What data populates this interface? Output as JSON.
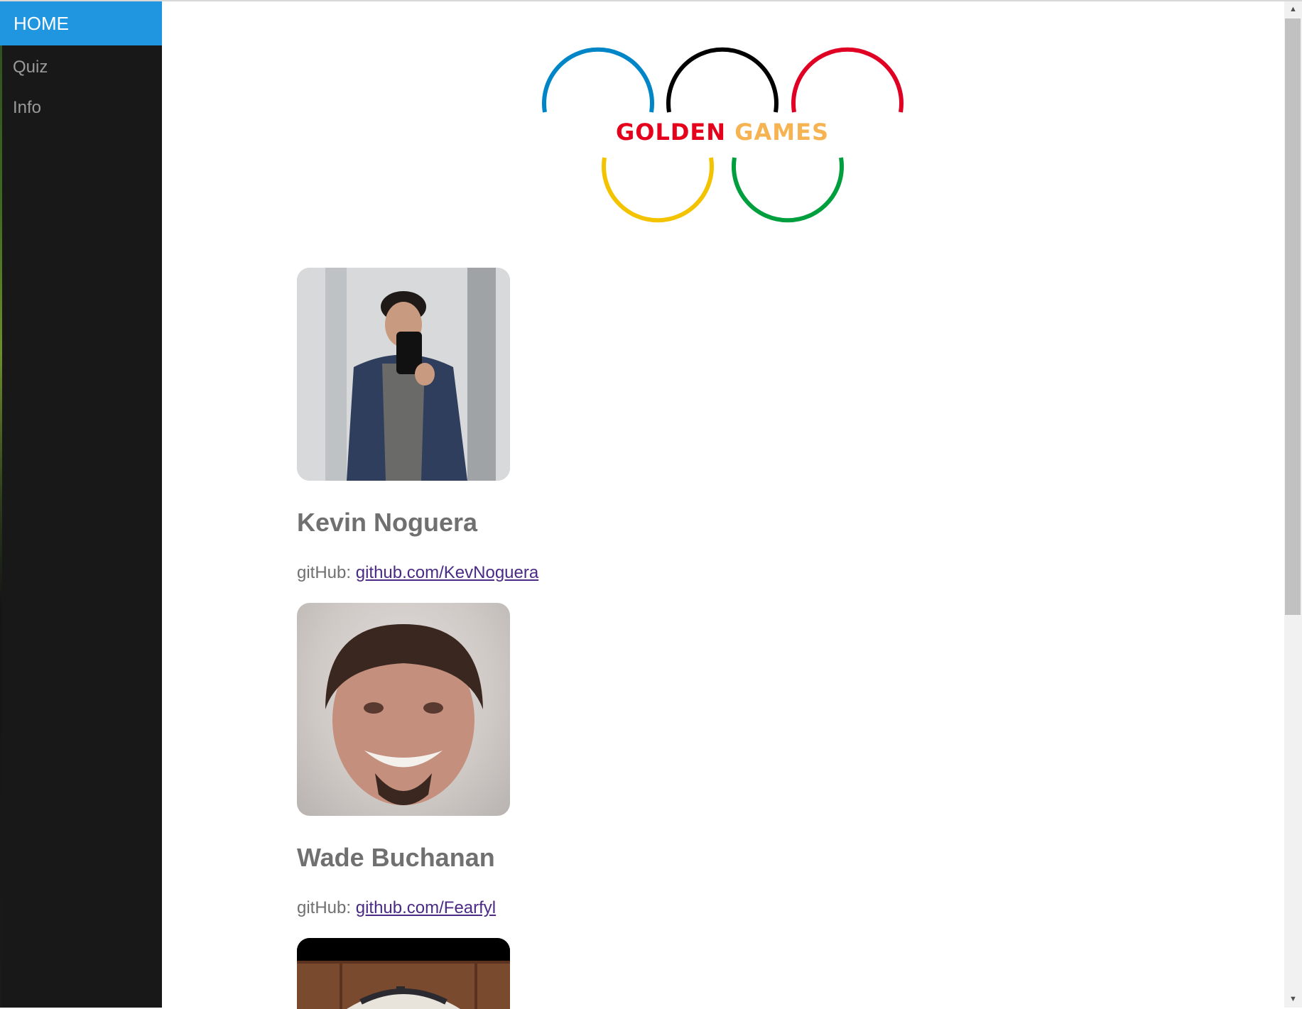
{
  "nav": {
    "items": [
      {
        "label": "HOME",
        "active": true
      },
      {
        "label": "Quiz",
        "active": false
      },
      {
        "label": "Info",
        "active": false
      }
    ]
  },
  "logo": {
    "word1": "GOLDEN",
    "word2": "GAMES",
    "ring_colors": [
      "#0085c7",
      "#000000",
      "#df0024",
      "#f4c300",
      "#009f3d"
    ]
  },
  "members": [
    {
      "name": "Kevin Noguera",
      "github_label": "gitHub:",
      "github_link": "github.com/KevNoguera"
    },
    {
      "name": "Wade Buchanan",
      "github_label": "gitHub:",
      "github_link": "github.com/Fearfyl"
    }
  ],
  "scrollbar": {
    "up_icon": "▲",
    "down_icon": "▼"
  }
}
